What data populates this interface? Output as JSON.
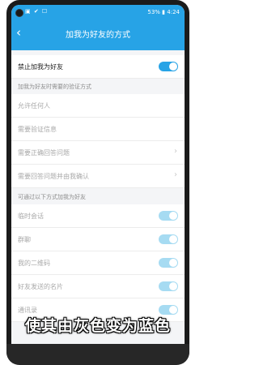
{
  "status_bar": {
    "left_icons": "▣ ✔ ☐",
    "right_text": "53%",
    "time": "4:24"
  },
  "header": {
    "title": "加我为好友的方式"
  },
  "main_toggle": {
    "label": "禁止加我为好友",
    "on": true
  },
  "section_verify": {
    "label": "加我为好友时需要的验证方式"
  },
  "verify_items": [
    {
      "label": "允许任何人"
    },
    {
      "label": "需要验证信息"
    },
    {
      "label": "需要正确回答问题"
    },
    {
      "label": "需要回答问题并由我确认"
    }
  ],
  "section_methods": {
    "label": "可通过以下方式加我为好友"
  },
  "method_items": [
    {
      "label": "临时会话"
    },
    {
      "label": "群聊"
    },
    {
      "label": "我的二维码"
    },
    {
      "label": "好友发送的名片"
    },
    {
      "label": "通讯录"
    }
  ],
  "caption": "使其由灰色变为蓝色",
  "colors": {
    "accent": "#27a3e6",
    "disabled_toggle": "#a6dbf2"
  }
}
